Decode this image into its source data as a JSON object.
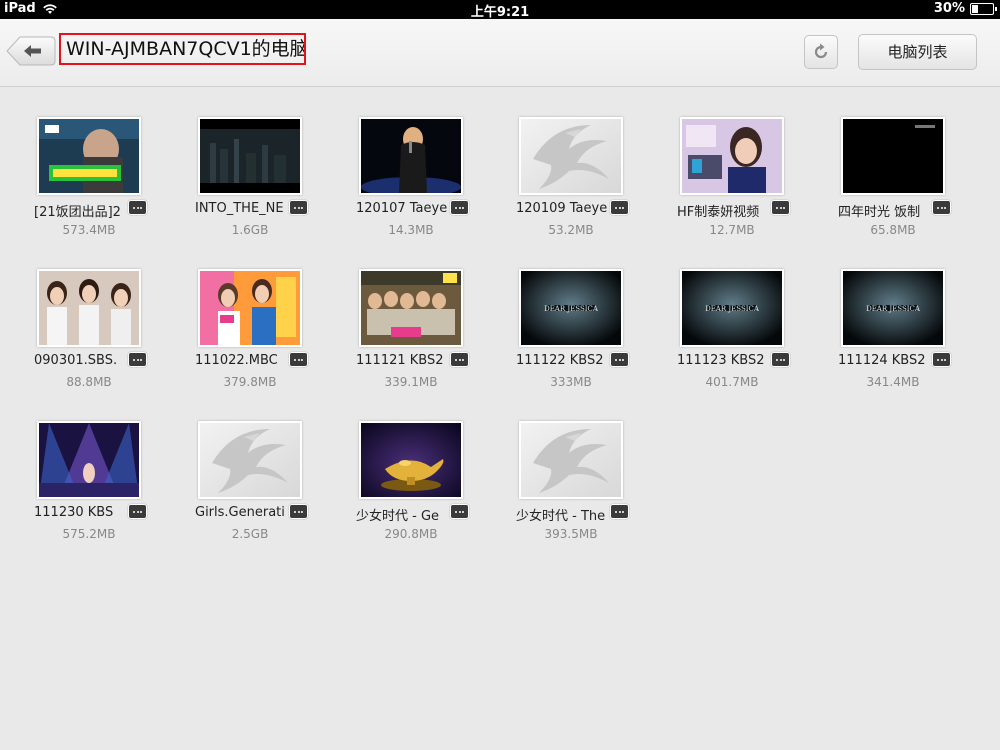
{
  "status_bar": {
    "device": "iPad",
    "time": "上午9:21",
    "battery": "30%",
    "battery_level": 0.3
  },
  "header": {
    "title": "WIN-AJMBAN7QCV1的电脑",
    "pc_list_label": "电脑列表"
  },
  "colors": {
    "highlight": "#e0141a",
    "background": "#e9e9e9"
  },
  "files": [
    {
      "name": "[21饭团出品]2",
      "size": "573.4MB",
      "thumb": "variety-show"
    },
    {
      "name": "INTO_THE_NE",
      "size": "1.6GB",
      "thumb": "city-night"
    },
    {
      "name": "120107 Taeye",
      "size": "14.3MB",
      "thumb": "stage-singer"
    },
    {
      "name": "120109 Taeye",
      "size": "53.2MB",
      "thumb": "placeholder"
    },
    {
      "name": "HF制泰妍视频",
      "size": "12.7MB",
      "thumb": "radio-studio"
    },
    {
      "name": "四年时光 饭制",
      "size": "65.8MB",
      "thumb": "black"
    },
    {
      "name": "090301.SBS.",
      "size": "88.8MB",
      "thumb": "group-white"
    },
    {
      "name": "111022.MBC",
      "size": "379.8MB",
      "thumb": "variety-pink"
    },
    {
      "name": "111121 KBS2",
      "size": "339.1MB",
      "thumb": "group-stage"
    },
    {
      "name": "111122 KBS2",
      "size": "333MB",
      "thumb": "dear-jessica"
    },
    {
      "name": "111123 KBS2",
      "size": "401.7MB",
      "thumb": "dear-jessica"
    },
    {
      "name": "111124 KBS2",
      "size": "341.4MB",
      "thumb": "dear-jessica"
    },
    {
      "name": "111230 KBS ",
      "size": "575.2MB",
      "thumb": "concert-purple"
    },
    {
      "name": "Girls.Generati",
      "size": "2.5GB",
      "thumb": "placeholder"
    },
    {
      "name": "少女时代 - Ge",
      "size": "290.8MB",
      "thumb": "genie-lamp"
    },
    {
      "name": "少女时代 - The",
      "size": "393.5MB",
      "thumb": "placeholder"
    }
  ]
}
